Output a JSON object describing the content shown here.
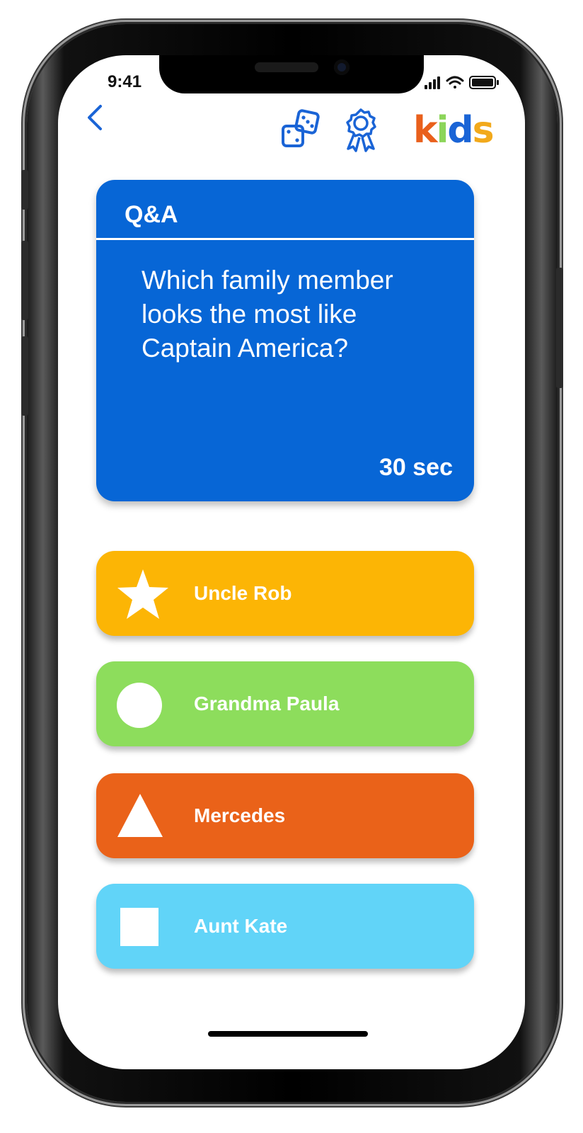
{
  "status_bar": {
    "time": "9:41"
  },
  "header": {
    "logo_text": [
      "k",
      "i",
      "d",
      "s"
    ]
  },
  "question_card": {
    "title": "Q&A",
    "question": "Which family member looks the most like Captain America?",
    "timer": "30 sec",
    "color": "#0766d6"
  },
  "answers": [
    {
      "label": "Uncle Rob",
      "shape": "star-icon",
      "color": "#fcb505"
    },
    {
      "label": "Grandma Paula",
      "shape": "circle-icon",
      "color": "#8ddd5c"
    },
    {
      "label": "Mercedes",
      "shape": "triangle-icon",
      "color": "#ea6219"
    },
    {
      "label": "Aunt Kate",
      "shape": "square-icon",
      "color": "#61d4f8"
    }
  ]
}
